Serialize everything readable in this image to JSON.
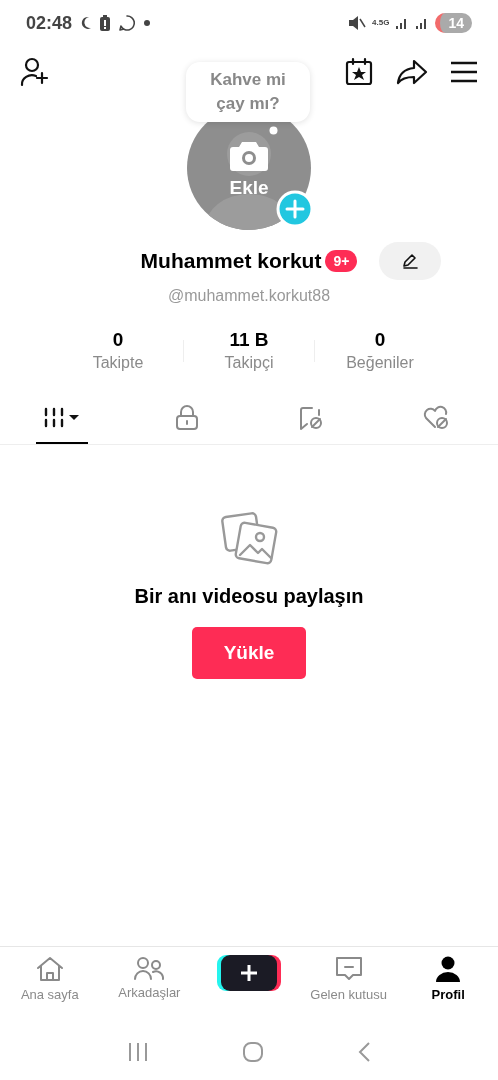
{
  "status_bar": {
    "time": "02:48",
    "network": "4.5G",
    "battery": "14"
  },
  "profile": {
    "tooltip": "Kahve mi\nçay mı?",
    "avatar_label": "Ekle",
    "name": "Muhammet korkut",
    "badge": "9+",
    "handle": "@muhammet.korkut88"
  },
  "stats": [
    {
      "value": "0",
      "label": "Takipte"
    },
    {
      "value": "11 B",
      "label": "Takipçi"
    },
    {
      "value": "0",
      "label": "Beğeniler"
    }
  ],
  "tabs": [
    {
      "kind": "videos",
      "selected": true
    },
    {
      "kind": "private",
      "selected": false
    },
    {
      "kind": "saved",
      "selected": false
    },
    {
      "kind": "liked",
      "selected": false
    }
  ],
  "empty_state": {
    "message": "Bir anı videosu paylaşın",
    "button": "Yükle"
  },
  "bottom_nav": [
    {
      "kind": "home",
      "label": "Ana sayfa",
      "selected": false
    },
    {
      "kind": "friends",
      "label": "Arkadaşlar",
      "selected": false
    },
    {
      "kind": "create"
    },
    {
      "kind": "inbox",
      "label": "Gelen kutusu",
      "selected": false
    },
    {
      "kind": "profile",
      "label": "Profil",
      "selected": true
    }
  ]
}
